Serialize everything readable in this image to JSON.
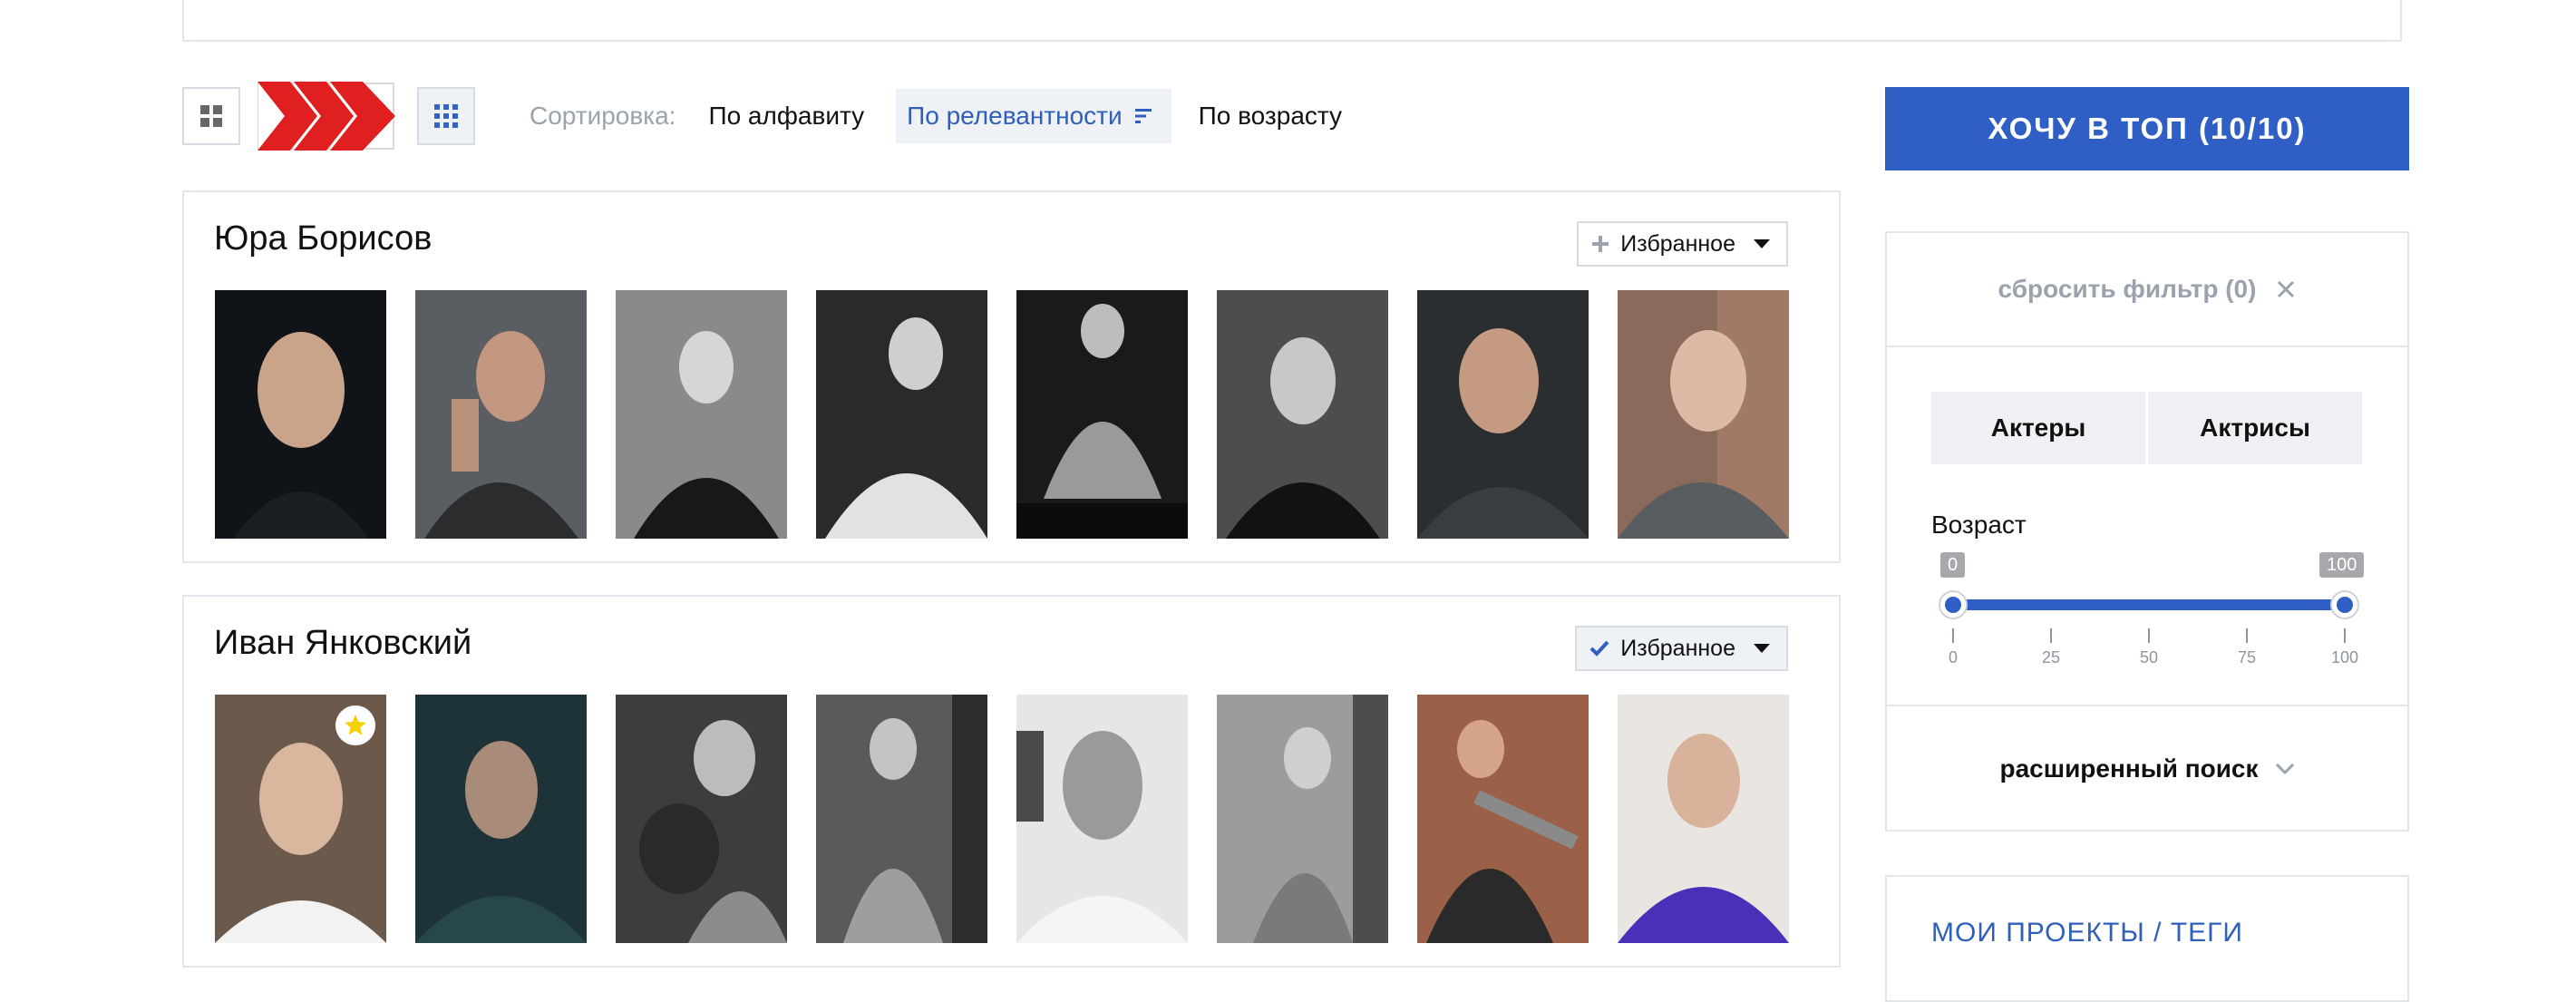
{
  "sort": {
    "label": "Сортировка:",
    "options": [
      {
        "label": "По алфавиту",
        "active": false
      },
      {
        "label": "По релевантности",
        "active": true
      },
      {
        "label": "По возрасту",
        "active": false
      }
    ]
  },
  "actors": [
    {
      "name": "Юра Борисов",
      "favorite_label": "Избранное",
      "favorite": false,
      "photo_count": 8
    },
    {
      "name": "Иван Янковский",
      "favorite_label": "Избранное",
      "favorite": true,
      "photo_count": 8
    }
  ],
  "sidebar": {
    "top_button": "ХОЧУ В ТОП (10/10)",
    "reset_filter": "сбросить фильтр (0)",
    "gender_tabs": [
      "Актеры",
      "Актрисы"
    ],
    "age_label": "Возраст",
    "age_min": "0",
    "age_max": "100",
    "age_ticks": [
      "0",
      "25",
      "50",
      "75",
      "100"
    ],
    "advanced_search": "расширенный поиск",
    "projects_title": "МОИ ПРОЕКТЫ / ТЕГИ"
  },
  "colors": {
    "accent": "#2f5fc4",
    "arrows": "#e02020",
    "muted": "#9aa3ad",
    "star": "#f5d000"
  }
}
